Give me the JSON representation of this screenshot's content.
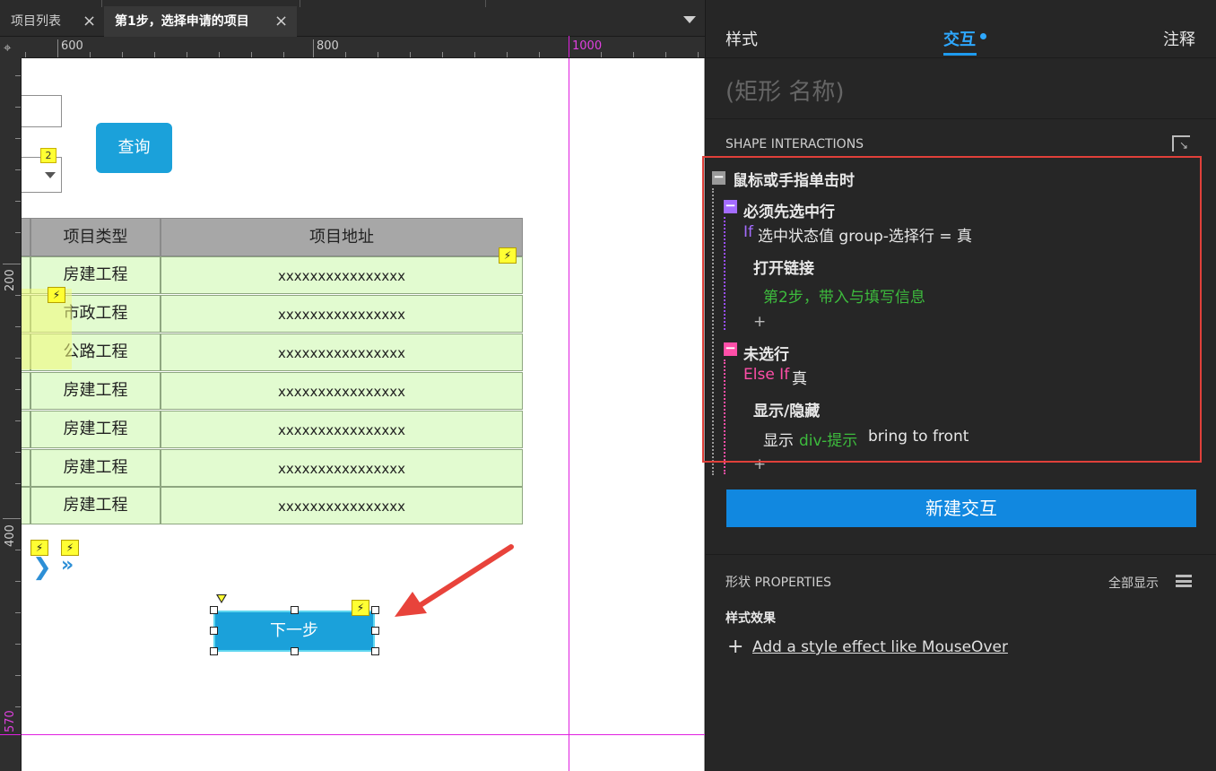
{
  "tabs": [
    {
      "label": "项目列表",
      "active": false
    },
    {
      "label": "第1步，选择申请的项目",
      "active": true
    }
  ],
  "ruler": {
    "top_labels": [
      "600",
      "800",
      "1000"
    ],
    "left_labels": [
      "200",
      "400",
      "570"
    ]
  },
  "canvas": {
    "select_badge": "2",
    "query_button": "查询",
    "table": {
      "headers": [
        "项目类型",
        "项目地址"
      ],
      "rows": [
        {
          "type": "房建工程",
          "address": "xxxxxxxxxxxxxxxx"
        },
        {
          "type": "市政工程",
          "address": "xxxxxxxxxxxxxxxx"
        },
        {
          "type": "公路工程",
          "address": "xxxxxxxxxxxxxxxx"
        },
        {
          "type": "房建工程",
          "address": "xxxxxxxxxxxxxxxx"
        },
        {
          "type": "房建工程",
          "address": "xxxxxxxxxxxxxxxx"
        },
        {
          "type": "房建工程",
          "address": "xxxxxxxxxxxxxxxx"
        },
        {
          "type": "房建工程",
          "address": "xxxxxxxxxxxxxxxx"
        }
      ]
    },
    "pager_next": "❯",
    "pager_last": "»",
    "next_button": "下一步"
  },
  "panel": {
    "tabs": {
      "style": "样式",
      "interact": "交互",
      "notes": "注释"
    },
    "shape_name": "(矩形 名称)",
    "interactions_label": "SHAPE INTERACTIONS",
    "event": "鼠标或手指单击时",
    "case1": {
      "name": "必须先选中行",
      "cond_keyword": "If",
      "cond_text": "选中状态值 group-选择行 = 真",
      "action": "打开链接",
      "target": "第2步，带入与填写信息"
    },
    "case2": {
      "name": "未选行",
      "cond_keyword": "Else If",
      "cond_text": "真",
      "action": "显示/隐藏",
      "detail_prefix": "显示",
      "detail_target": "div-提示",
      "detail_suffix": "bring to front"
    },
    "plus": "+",
    "new_interaction": "新建交互",
    "props_label": "形状 PROPERTIES",
    "show_all": "全部显示",
    "style_effects": "样式效果",
    "add_style": "Add a style effect like MouseOver"
  },
  "colors": {
    "accent": "#1188e0",
    "button": "#1ba1da",
    "guide": "#e020e0",
    "annotation_red": "#e0403a",
    "row_fill": "#e2fbd0"
  }
}
